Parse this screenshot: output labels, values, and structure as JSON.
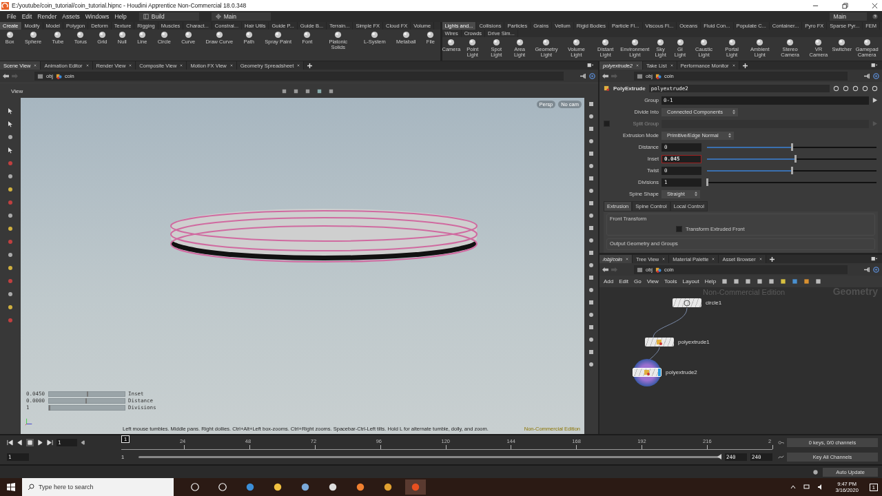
{
  "window": {
    "title": "E:/youtube/coin_tutorial/coin_tutorial.hipnc - Houdini Apprentice Non-Commercial 18.0.348"
  },
  "menu": [
    "File",
    "Edit",
    "Render",
    "Assets",
    "Windows",
    "Help"
  ],
  "desktop": {
    "build": "Build",
    "main": "Main",
    "right": "Main"
  },
  "shelf_left": {
    "tabs": [
      {
        "label": "Create",
        "selected": true
      },
      {
        "label": "Modify",
        "selected": false
      },
      {
        "label": "Model",
        "selected": false
      },
      {
        "label": "Polygon",
        "selected": false
      },
      {
        "label": "Deform",
        "selected": false
      },
      {
        "label": "Texture",
        "selected": false
      },
      {
        "label": "Rigging",
        "selected": false
      },
      {
        "label": "Muscles",
        "selected": false
      },
      {
        "label": "Charact...",
        "selected": false
      },
      {
        "label": "Constrai...",
        "selected": false
      },
      {
        "label": "Hair Utils",
        "selected": false
      },
      {
        "label": "Guide P...",
        "selected": false
      },
      {
        "label": "Guide B...",
        "selected": false
      },
      {
        "label": "Terrain...",
        "selected": false
      },
      {
        "label": "Simple FX",
        "selected": false
      },
      {
        "label": "Cloud FX",
        "selected": false
      },
      {
        "label": "Volume",
        "selected": false
      }
    ],
    "tools": [
      "Box",
      "Sphere",
      "Tube",
      "Torus",
      "Grid",
      "Null",
      "Line",
      "Circle",
      "Curve",
      "Draw Curve",
      "Path",
      "Spray Paint",
      "Font",
      "Platonic Solids",
      "L-System",
      "Metaball",
      "File"
    ]
  },
  "shelf_right": {
    "tabs": [
      {
        "label": "Lights and...",
        "selected": true
      },
      {
        "label": "Collisions",
        "selected": false
      },
      {
        "label": "Particles",
        "selected": false
      },
      {
        "label": "Grains",
        "selected": false
      },
      {
        "label": "Vellum",
        "selected": false
      },
      {
        "label": "Rigid Bodies",
        "selected": false
      },
      {
        "label": "Particle Fl...",
        "selected": false
      },
      {
        "label": "Viscous Fl...",
        "selected": false
      },
      {
        "label": "Oceans",
        "selected": false
      },
      {
        "label": "Fluid Con...",
        "selected": false
      },
      {
        "label": "Populate C...",
        "selected": false
      },
      {
        "label": "Container...",
        "selected": false
      },
      {
        "label": "Pyro FX",
        "selected": false
      },
      {
        "label": "Sparse Pyr...",
        "selected": false
      },
      {
        "label": "FEM",
        "selected": false
      },
      {
        "label": "Wires",
        "selected": false
      },
      {
        "label": "Crowds",
        "selected": false
      },
      {
        "label": "Drive Sim...",
        "selected": false
      }
    ],
    "tools": [
      "Camera",
      "Point Light",
      "Spot Light",
      "Area Light",
      "Geometry Light",
      "Volume Light",
      "Distant Light",
      "Environment Light",
      "Sky Light",
      "GI Light",
      "Caustic Light",
      "Portal Light",
      "Ambient Light",
      "Stereo Camera",
      "VR Camera",
      "Switcher",
      "Gamepad Camera"
    ]
  },
  "scene_pane": {
    "tabs": [
      {
        "label": "Scene View",
        "selected": true
      },
      {
        "label": "Animation Editor",
        "selected": false
      },
      {
        "label": "Render View",
        "selected": false
      },
      {
        "label": "Composite View",
        "selected": false
      },
      {
        "label": "Motion FX View",
        "selected": false
      },
      {
        "label": "Geometry Spreadsheet",
        "selected": false
      }
    ],
    "path": [
      "obj",
      "coin"
    ],
    "toolbar_title": "View",
    "camera_menus": [
      "Persp",
      "No cam"
    ],
    "hud": [
      {
        "value": "0.0450",
        "label": "Inset",
        "level": 0.5
      },
      {
        "value": "0.0000",
        "label": "Distance",
        "level": 0.48
      },
      {
        "value": "1",
        "label": "Divisions",
        "level": 0
      }
    ],
    "status": "Left mouse tumbles. Middle pans. Right dollies. Ctrl+Alt+Left box-zooms. Ctrl+Right zooms. Spacebar-Ctrl-Left tilts. Hold L for alternate tumble, dolly, and zoom.",
    "edition": "Non-Commercial Edition"
  },
  "param_pane": {
    "tabs": [
      {
        "label": "polyextrude2",
        "selected": true
      },
      {
        "label": "Take List",
        "selected": false
      },
      {
        "label": "Performance Monitor",
        "selected": false
      }
    ],
    "path": [
      "obj",
      "coin"
    ],
    "node_type": "PolyExtrude",
    "node_name": "polyextrude2",
    "params": [
      {
        "kind": "field",
        "label": "Group",
        "value": "0-1",
        "disabled": false
      },
      {
        "kind": "menu",
        "label": "Divide Into",
        "value": "Connected Components",
        "disabled": false
      },
      {
        "kind": "toggle_field",
        "label": "Split Group",
        "disabled": true,
        "checked": false
      },
      {
        "kind": "menu",
        "label": "Extrusion Mode",
        "value": "Primitive/Edge Normal",
        "disabled": false
      },
      {
        "kind": "slider",
        "label": "Distance",
        "value": "0",
        "level": 0.5,
        "focused": false,
        "disabled": false
      },
      {
        "kind": "slider",
        "label": "Inset",
        "value": "0.045",
        "level": 0.52,
        "focused": true,
        "disabled": false
      },
      {
        "kind": "slider",
        "label": "Twist",
        "value": "0",
        "level": 0.5,
        "focused": false,
        "disabled": false
      },
      {
        "kind": "int_slider",
        "label": "Divisions",
        "value": "1",
        "level": 0,
        "focused": false,
        "disabled": false
      },
      {
        "kind": "menu",
        "label": "Spine Shape",
        "value": "Straight",
        "disabled": false
      }
    ],
    "sub_tabs": [
      {
        "label": "Extrusion",
        "selected": true
      },
      {
        "label": "Spine Control",
        "selected": false
      },
      {
        "label": "Local Control",
        "selected": false
      }
    ],
    "sections": [
      {
        "title": "Front Transform",
        "toggle": {
          "label": "Transform Extruded Front",
          "checked": false
        }
      },
      {
        "title": "Output Geometry and Groups"
      }
    ]
  },
  "network_pane": {
    "tabs": [
      {
        "label": "/obj/coin",
        "selected": true
      },
      {
        "label": "Tree View",
        "selected": false
      },
      {
        "label": "Material Palette",
        "selected": false
      },
      {
        "label": "Asset Browser",
        "selected": false
      }
    ],
    "path": [
      "obj",
      "coin"
    ],
    "menu": [
      "Add",
      "Edit",
      "Go",
      "View",
      "Tools",
      "Layout",
      "Help"
    ],
    "watermark": "Non-Commercial Edition",
    "context": "Geometry",
    "nodes": [
      {
        "name": "circle1",
        "kind": "circle",
        "selected": false,
        "display": false
      },
      {
        "name": "polyextrude1",
        "kind": "polyextrude",
        "selected": false,
        "display": false
      },
      {
        "name": "polyextrude2",
        "kind": "polyextrude",
        "selected": true,
        "display": true
      }
    ]
  },
  "timeline": {
    "frame": "1",
    "cursor": "1",
    "ticks": [
      "24",
      "48",
      "72",
      "96",
      "120",
      "144",
      "168",
      "192",
      "216",
      "2"
    ],
    "range_start": "1",
    "range_start2": "1",
    "range": {
      "level": 1
    },
    "range_end": "240",
    "range_end2": "240",
    "keys": "0 keys, 0/0 channels",
    "key_mode": "Key All Channels"
  },
  "status_bar": {
    "update_mode": "Auto Update"
  },
  "taskbar": {
    "search_placeholder": "Type here to search",
    "time": "9:47 PM",
    "date": "3/16/2020",
    "notifications": "1"
  }
}
